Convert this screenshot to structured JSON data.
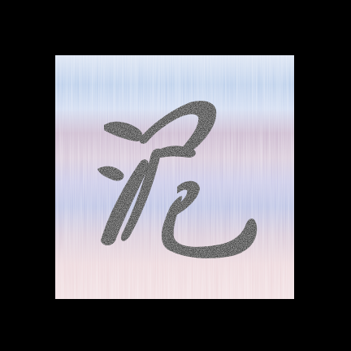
{
  "image": {
    "subject": "calligraphy-tile",
    "glyph": "泥",
    "ink_color": "#3a3a3a",
    "background_colors": [
      "#c9d6ee",
      "#b7cbe6",
      "#cdb9cf",
      "#c2c4e2",
      "#e8d6dc"
    ],
    "frame_color": "#000000"
  }
}
